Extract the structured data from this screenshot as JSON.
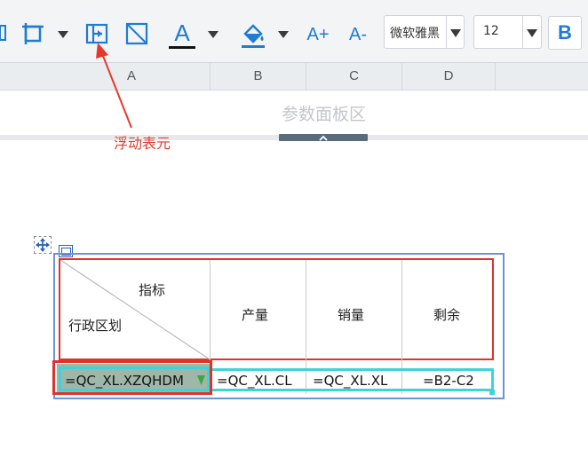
{
  "toolbar": {
    "font_name": "微软雅黑",
    "font_size": "12",
    "bold_label": "B",
    "font_color_glyph": "A",
    "increase_font_glyph": "A+",
    "decrease_font_glyph": "A-",
    "icons": [
      "left-edge-icon",
      "freeze-icon",
      "dropdown-caret-icon",
      "floating-element-icon",
      "diagonal-split-icon",
      "font-color-icon",
      "fill-color-icon",
      "increase-font-icon",
      "decrease-font-icon",
      "bold-icon"
    ]
  },
  "columns": [
    "A",
    "B",
    "C",
    "D"
  ],
  "param_panel": {
    "title": "参数面板区"
  },
  "annotation": {
    "label": "浮动表元",
    "color": "#e53a2a"
  },
  "table": {
    "header": {
      "diagonal_top": "指标",
      "diagonal_bottom": "行政区划",
      "col_b": "产量",
      "col_c": "销量",
      "col_d": "剩余"
    },
    "row2": {
      "a": "=QC_XL.XZQHDM",
      "b": "=QC_XL.CL",
      "c": "=QC_XL.XL",
      "d": "=B2-C2"
    }
  },
  "colors": {
    "accent_blue": "#1f7bd6",
    "selection_blue": "#6b93d6",
    "red": "#e0322c",
    "cyan": "#3fd3d8"
  }
}
